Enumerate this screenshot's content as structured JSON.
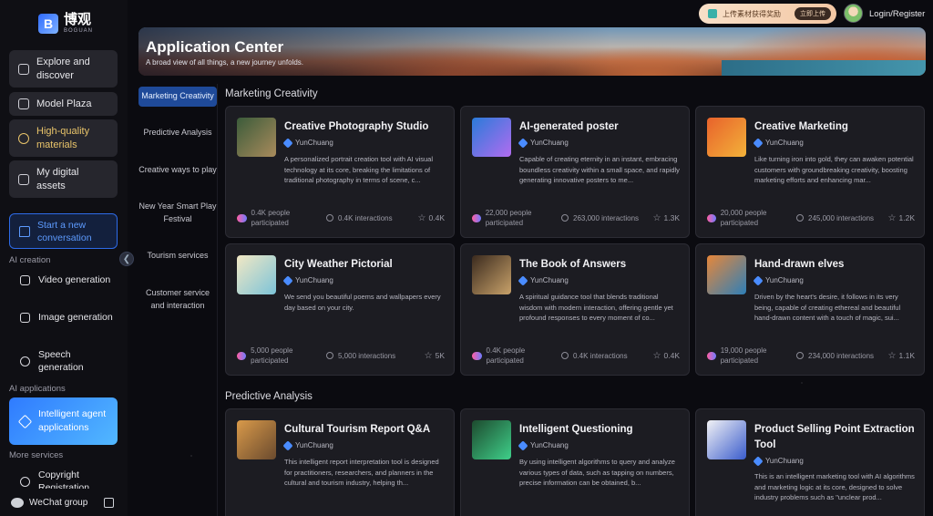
{
  "logo": {
    "mark": "B",
    "cn": "博观",
    "en": "BOGUAN"
  },
  "sidebar": {
    "top_items": [
      {
        "label": "Explore and discover",
        "icon": "grid-icon"
      },
      {
        "label": "Model Plaza",
        "icon": "cube-icon"
      },
      {
        "label": "High-quality materials",
        "icon": "medal-icon"
      },
      {
        "label": "My digital assets",
        "icon": "folder-icon"
      }
    ],
    "new_conversation": "Start a new conversation",
    "sections": {
      "ai_creation": "AI creation",
      "ai_applications": "AI applications",
      "more_services": "More services"
    },
    "creation_items": [
      {
        "label": "Video generation",
        "icon": "video-icon"
      },
      {
        "label": "Image generation",
        "icon": "image-icon"
      },
      {
        "label": "Speech generation",
        "icon": "speech-icon"
      }
    ],
    "active_item": "Intelligent agent applications",
    "more_items": [
      {
        "label": "Copyright Registration",
        "icon": "copyright-icon"
      }
    ],
    "bottom": {
      "wechat": "WeChat group"
    }
  },
  "topbar": {
    "upload_promo": "上传素材获得奖励",
    "upload_now": "立即上传",
    "login": "Login/Register"
  },
  "banner": {
    "title": "Application Center",
    "subtitle": "A broad view of all things, a new journey unfolds."
  },
  "categories": [
    "Marketing Creativity",
    "Predictive Analysis",
    "Creative ways to play",
    "New Year Smart Play Festival",
    "Tourism services",
    "Customer service and interaction"
  ],
  "active_category": "Marketing Creativity",
  "sections": [
    {
      "title": "Marketing Creativity",
      "cards": [
        {
          "title": "Creative Photography Studio",
          "author": "YunChuang",
          "description": "A personalized portrait creation tool with AI visual technology at its core, breaking the limitations of traditional photography in terms of scene, c...",
          "people": "0.4K people participated",
          "interactions": "0.4K interactions",
          "stars": "0.4K",
          "thumb_colors": [
            "#3b5b3a",
            "#a98b5c"
          ]
        },
        {
          "title": "AI-generated poster",
          "author": "YunChuang",
          "description": "Capable of creating eternity in an instant, embracing boundless creativity within a small space, and rapidly generating innovative posters to me...",
          "people": "22,000 people participated",
          "interactions": "263,000 interactions",
          "stars": "1.3K",
          "thumb_colors": [
            "#2a7bd9",
            "#b26cf0"
          ]
        },
        {
          "title": "Creative Marketing",
          "author": "YunChuang",
          "description": "Like turning iron into gold, they can awaken potential customers with groundbreaking creativity, boosting marketing efforts and enhancing mar...",
          "people": "20,000 people participated",
          "interactions": "245,000 interactions",
          "stars": "1.2K",
          "thumb_colors": [
            "#e8622b",
            "#f3b23a"
          ]
        },
        {
          "title": "City Weather Pictorial",
          "author": "YunChuang",
          "description": "We send you beautiful poems and wallpapers every day based on your city.",
          "people": "5,000 people participated",
          "interactions": "5,000 interactions",
          "stars": "5K",
          "thumb_colors": [
            "#f2e8c4",
            "#7cc3d8"
          ]
        },
        {
          "title": "The Book of Answers",
          "author": "YunChuang",
          "description": "A spiritual guidance tool that blends traditional wisdom with modern interaction, offering gentle yet profound responses to every moment of co...",
          "people": "0.4K people participated",
          "interactions": "0.4K interactions",
          "stars": "0.4K",
          "thumb_colors": [
            "#3a2a1e",
            "#c9a26a"
          ]
        },
        {
          "title": "Hand-drawn elves",
          "author": "YunChuang",
          "description": "Driven by the heart's desire, it follows in its very being, capable of creating ethereal and beautiful hand-drawn content with a touch of magic, sui...",
          "people": "19,000 people participated",
          "interactions": "234,000 interactions",
          "stars": "1.1K",
          "thumb_colors": [
            "#e7873a",
            "#2e7fb8"
          ]
        }
      ]
    },
    {
      "title": "Predictive Analysis",
      "cards": [
        {
          "title": "Cultural Tourism Report Q&A",
          "author": "YunChuang",
          "description": "This intelligent report interpretation tool is designed for practitioners, researchers, and planners in the cultural and tourism industry, helping th...",
          "people": "",
          "interactions": "",
          "stars": "",
          "thumb_colors": [
            "#d99a4a",
            "#6a4a2e"
          ]
        },
        {
          "title": "Intelligent Questioning",
          "author": "YunChuang",
          "description": "By using intelligent algorithms to query and analyze various types of data, such as tapping on numbers, precise information can be obtained, b...",
          "people": "",
          "interactions": "",
          "stars": "",
          "thumb_colors": [
            "#1d4a2e",
            "#3fd08a"
          ]
        },
        {
          "title": "Product Selling Point Extraction Tool",
          "author": "YunChuang",
          "description": "This is an intelligent marketing tool with AI algorithms and marketing logic at its core, designed to solve industry problems such as \"unclear prod...",
          "people": "",
          "interactions": "",
          "stars": "",
          "thumb_colors": [
            "#f2f2f5",
            "#3a5ccc"
          ]
        }
      ]
    }
  ]
}
